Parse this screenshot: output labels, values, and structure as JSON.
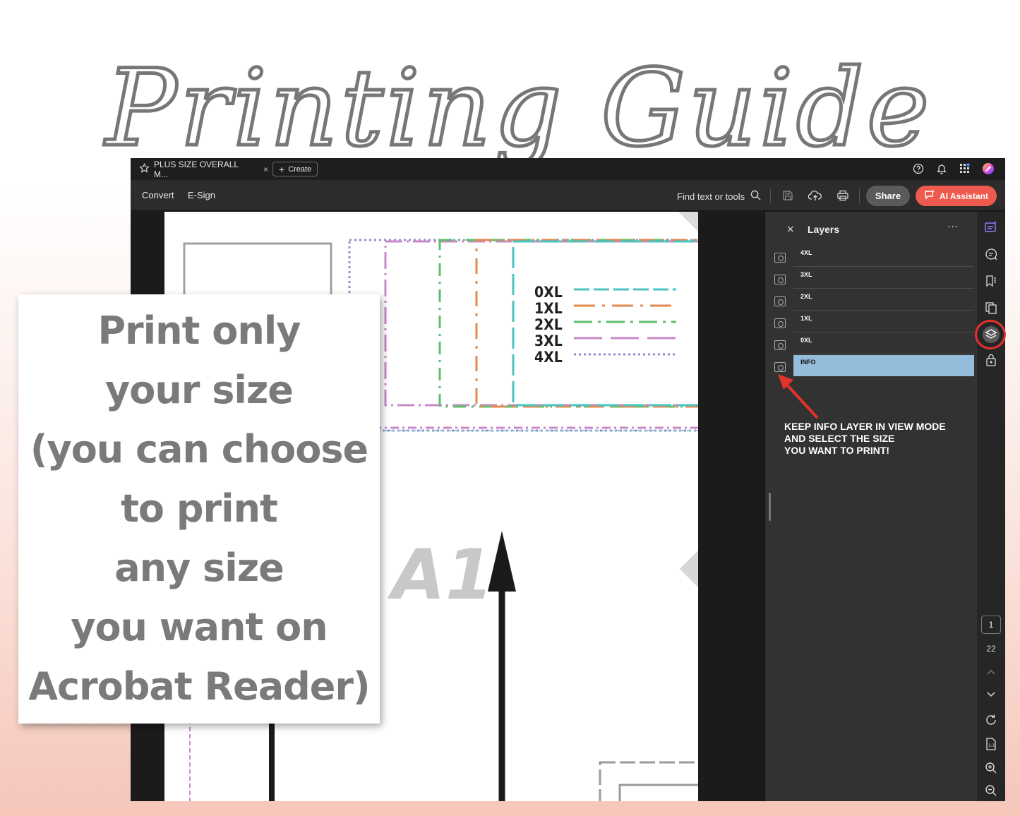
{
  "title_graphic": "Printing Guide",
  "window": {
    "tab_title": "PLUS SIZE OVERALL M...",
    "tab_close": "×",
    "create_label": "Create"
  },
  "toolbar": {
    "convert": "Convert",
    "esign": "E-Sign",
    "find": "Find text or tools",
    "share": "Share",
    "ai_assistant": "AI Assistant"
  },
  "document": {
    "size_legend": [
      "0XL",
      "1XL",
      "2XL",
      "3XL",
      "4XL"
    ],
    "piece_label": "A1"
  },
  "layers_panel": {
    "close": "×",
    "title": "Layers",
    "more": "···",
    "layers": [
      {
        "name": "4XL",
        "selected": false
      },
      {
        "name": "3XL",
        "selected": false
      },
      {
        "name": "2XL",
        "selected": false
      },
      {
        "name": "1XL",
        "selected": false
      },
      {
        "name": "0XL",
        "selected": false
      },
      {
        "name": "INFO",
        "selected": true
      }
    ],
    "note": [
      "KEEP INFO LAYER IN VIEW MODE",
      "AND SELECT THE SIZE",
      "YOU WANT TO PRINT!"
    ]
  },
  "rail": {
    "current_page": "1",
    "total_pages": "22"
  },
  "callout": {
    "lines": [
      "Print only",
      "your size",
      "(you can choose",
      "to print",
      "any size",
      "you want on",
      "Acrobat Reader)"
    ]
  },
  "colors": {
    "ai_button": "#ef5a4e",
    "selected_layer": "#94bcdb",
    "highlight_ring": "#e5312b",
    "size_0xl": "#4cc3c0",
    "size_1xl": "#e38a4e",
    "size_2xl": "#5cbf6a",
    "size_3xl": "#c989c9",
    "size_4xl": "#8f8fd0"
  }
}
